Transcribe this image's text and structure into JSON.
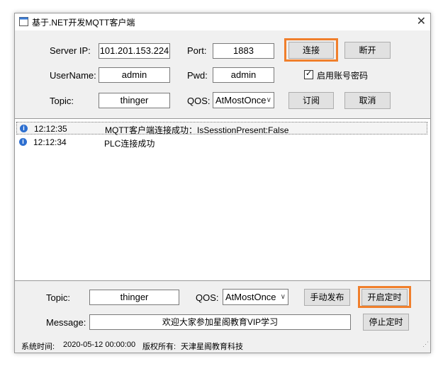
{
  "window": {
    "title": "基于.NET开发MQTT客户端",
    "close_glyph": "✕"
  },
  "conn": {
    "server_ip_label": "Server IP:",
    "server_ip": "101.201.153.224",
    "port_label": "Port:",
    "port": "1883",
    "connect_label": "连接",
    "disconnect_label": "断开",
    "username_label": "UserName:",
    "username": "admin",
    "pwd_label": "Pwd:",
    "pwd": "admin",
    "use_account_label": "启用账号密码",
    "topic_label": "Topic:",
    "topic": "thinger",
    "qos_label": "QOS:",
    "qos": "AtMostOnce",
    "subscribe_label": "订阅",
    "cancel_label": "取消"
  },
  "log": {
    "rows": [
      {
        "time": "12:12:35",
        "message": "MQTT客户端连接成功：IsSesstionPresent:False"
      },
      {
        "time": "12:12:34",
        "message": "PLC连接成功"
      }
    ]
  },
  "publish": {
    "topic_label": "Topic:",
    "topic": "thinger",
    "qos_label": "QOS:",
    "qos": "AtMostOnce",
    "manual_label": "手动发布",
    "start_timer_label": "开启定时",
    "message_label": "Message:",
    "message": "欢迎大家参加星阁教育VIP学习",
    "stop_timer_label": "停止定时"
  },
  "status": {
    "time_label": "系统时间:",
    "time": "2020-05-12 00:00:00",
    "copyright_label": "版权所有:",
    "copyright": "天津星阁教育科技"
  },
  "colors": {
    "highlight": "#f07f2c",
    "info_icon": "#2d6fd0"
  },
  "icons": {
    "app": "app-icon",
    "info": "info-icon",
    "dropdown": "chevron-down-icon"
  }
}
